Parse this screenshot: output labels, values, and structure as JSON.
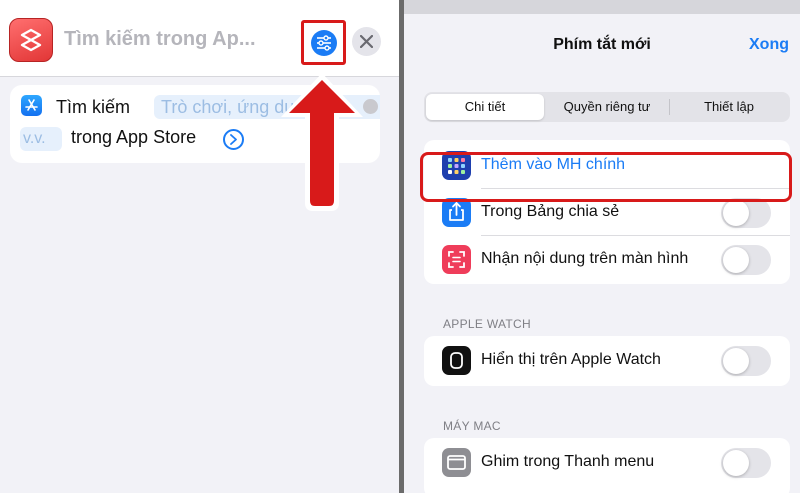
{
  "left_pane": {
    "header": {
      "search_title": "Tìm kiếm trong Ap...",
      "settings_icon": "sliders-icon",
      "close_icon": "close-icon"
    },
    "action": {
      "verb": "Tìm kiếm",
      "param_placeholder": "Trò chơi, ứng dụ",
      "param_placeholder_cont": "v.v.",
      "suffix": "trong App Store",
      "app_icon": "app-store-icon"
    }
  },
  "right_pane": {
    "title": "Phím tắt mới",
    "done_label": "Xong",
    "tabs": [
      {
        "label": "Chi tiết",
        "active": true
      },
      {
        "label": "Quyền riêng tư",
        "active": false
      },
      {
        "label": "Thiết lập",
        "active": false
      }
    ],
    "details_group": [
      {
        "label": "Thêm vào MH chính",
        "icon": "home-screen-grid-icon",
        "toggle": null
      },
      {
        "label": "Trong Bảng chia sẻ",
        "icon": "share-icon",
        "toggle": false
      },
      {
        "label": "Nhận nội dung trên màn hình",
        "icon": "screen-capture-icon",
        "toggle": false
      }
    ],
    "apple_watch": {
      "header": "APPLE WATCH",
      "items": [
        {
          "label": "Hiển thị trên Apple Watch",
          "icon": "apple-watch-icon",
          "toggle": false
        }
      ]
    },
    "mac": {
      "header": "MÁY MAC",
      "items": [
        {
          "label": "Ghim trong Thanh menu",
          "icon": "menu-bar-icon",
          "toggle": false
        }
      ]
    }
  },
  "colors": {
    "accent_blue": "#1b7cf5",
    "annotation_red": "#d81a1a",
    "background": "#f2f2f7"
  }
}
